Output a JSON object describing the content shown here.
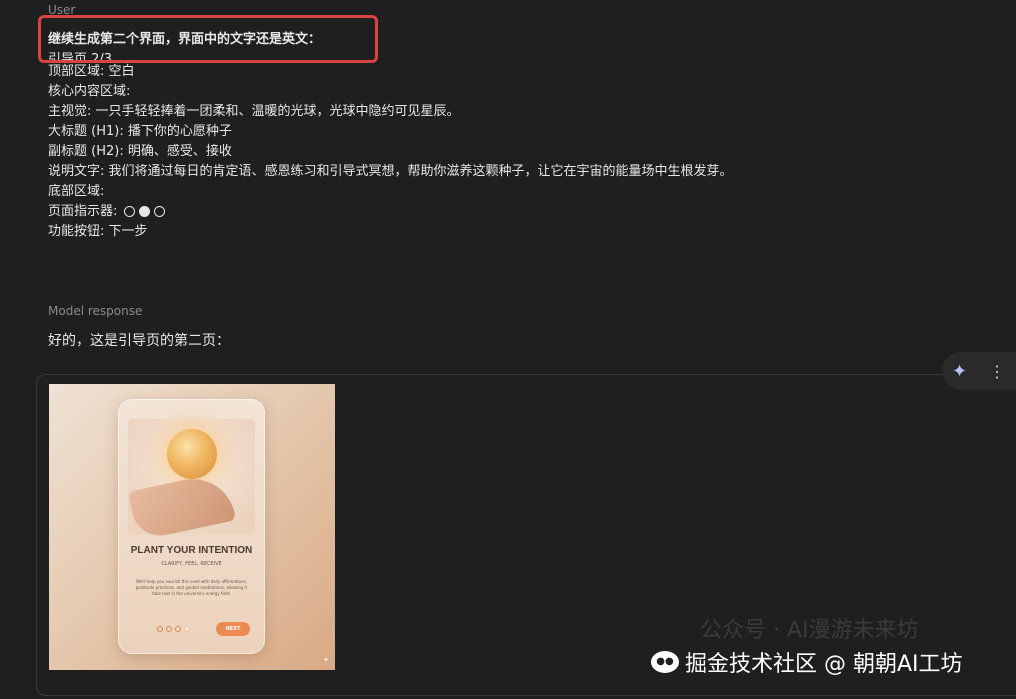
{
  "user": {
    "label": "User",
    "lines": [
      "继续生成第二个界面，界面中的文字还是英文：",
      "引导页 2/3",
      "顶部区域: 空白",
      "核心内容区域:",
      "主视觉: 一只手轻轻捧着一团柔和、温暖的光球，光球中隐约可见星辰。",
      "大标题 (H1): 播下你的心愿种子",
      "副标题 (H2): 明确、感受、接收",
      "说明文字: 我们将通过每日的肯定语、感恩练习和引导式冥想，帮助你滋养这颗种子，让它在宇宙的能量场中生根发芽。",
      "底部区域:",
      "页面指示器:",
      "功能按钮: 下一步"
    ]
  },
  "model": {
    "label": "Model response",
    "text": "好的，这是引导页的第二页："
  },
  "image": {
    "title": "PLANT YOUR INTENTION",
    "subtitle": "CLARIFY, FEEL, RECEIVE",
    "description": "We'll help you nourish this seed with daily affirmations, gratitude practices, and guided meditations, allowing it take root in the universe's energy field.",
    "next_label": "NEXT"
  },
  "toolbar": {
    "spark_icon": "✦",
    "more_icon": "⋮"
  },
  "watermark": {
    "faded": "公众号 · AI漫游未来坊",
    "main": "掘金技术社区 @ 朝朝AI工坊"
  }
}
